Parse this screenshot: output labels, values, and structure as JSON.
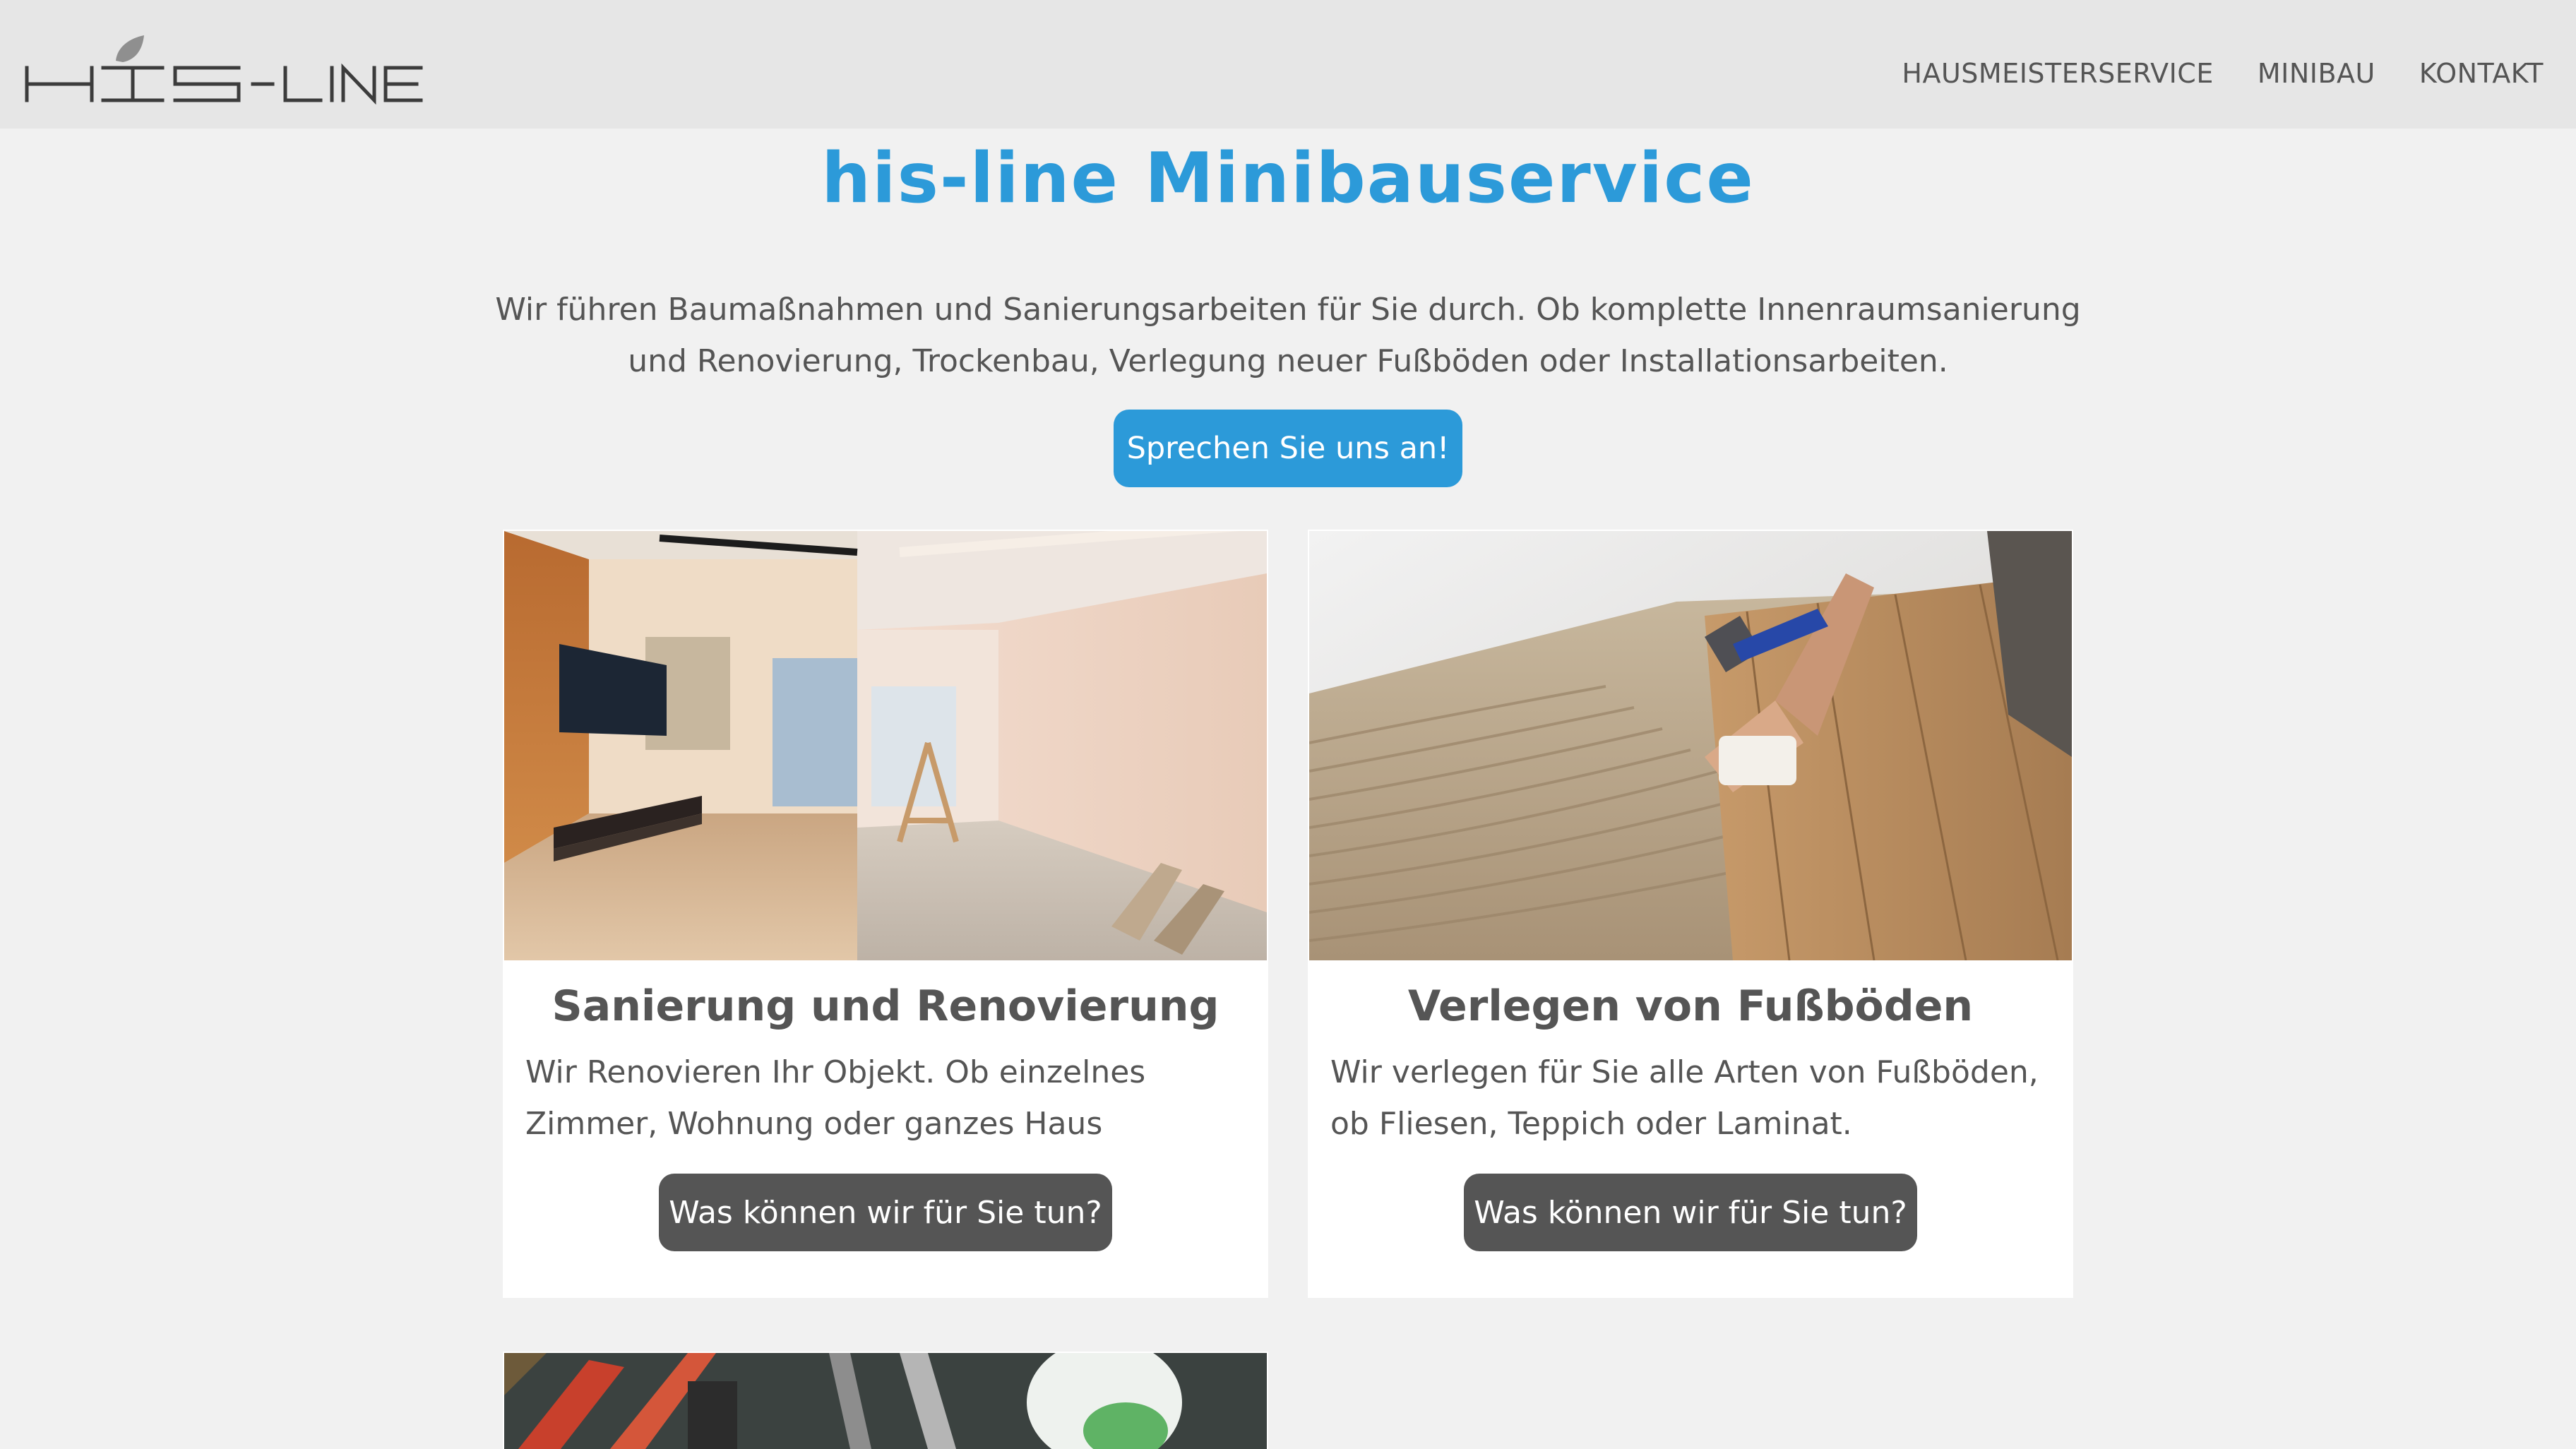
{
  "header": {
    "logo_text": "HIS-LINE",
    "nav": [
      "HAUSMEISTERSERVICE",
      "MINIBAU",
      "KONTAKT"
    ]
  },
  "hero": {
    "title": "his-line Minibauservice",
    "text": "Wir führen Baumaßnahmen und Sanierungsarbeiten für Sie durch. Ob komplette Innenraumsanierung und Renovierung, Trockenbau, Verlegung neuer Fußböden oder Installationsarbeiten.",
    "cta_label": "Sprechen Sie uns an!"
  },
  "cards": [
    {
      "title": "Sanierung und Renovierung",
      "text": "Wir Renovieren Ihr Objekt. Ob einzelnes Zimmer, Wohnung oder ganzes Haus",
      "button_label": "Was können wir für Sie tun?",
      "image": "room-renovation-photo"
    },
    {
      "title": "Verlegen von Fußböden",
      "text": "Wir verlegen für Sie alle Arten von Fußböden, ob Fliesen, Teppich oder Laminat.",
      "button_label": "Was können wir für Sie tun?",
      "image": "floor-laying-photo"
    },
    {
      "image": "tools-photo"
    }
  ],
  "colors": {
    "accent": "#2c9ad9",
    "text": "#555555",
    "background": "#f1f1f1",
    "header_bg": "#e6e6e6",
    "card_bg": "#ffffff"
  }
}
